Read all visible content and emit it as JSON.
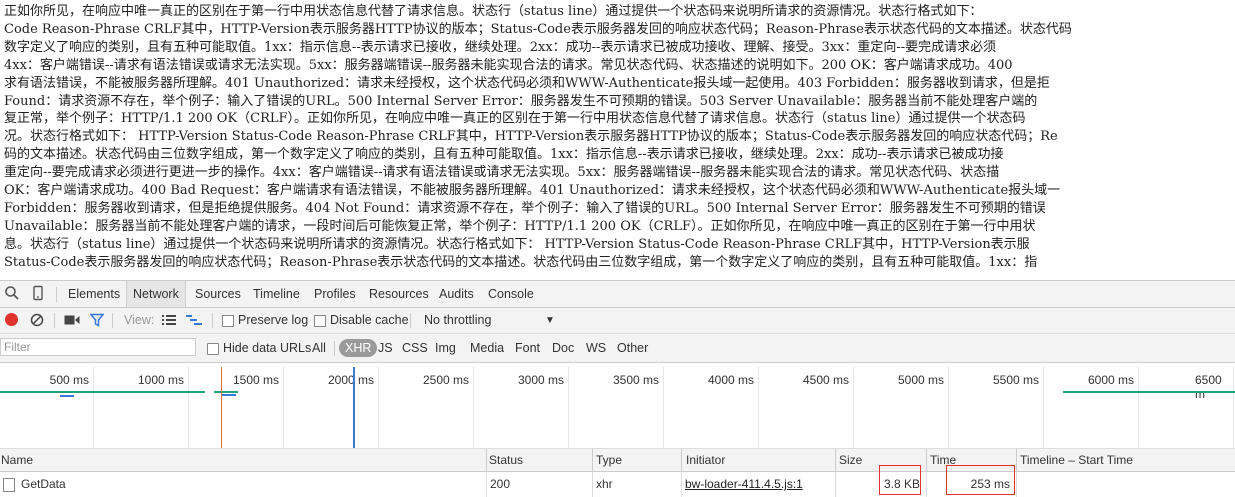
{
  "page_text": {
    "lines": [
      "正如你所见，在响应中唯一真正的区别在于第一行中用状态信息代替了请求信息。状态行（status line）通过提供一个状态码来说明所请求的资源情况。状态行格式如下：",
      "Code Reason-Phrase CRLF其中，HTTP-Version表示服务器HTTP协议的版本；Status-Code表示服务器发回的响应状态代码；Reason-Phrase表示状态代码的文本描述。状态代码",
      "数字定义了响应的类别，且有五种可能取值。1xx：指示信息--表示请求已接收，继续处理。2xx：成功--表示请求已被成功接收、理解、接受。3xx：重定向--要完成请求必须",
      "4xx：客户端错误--请求有语法错误或请求无法实现。5xx：服务器端错误--服务器未能实现合法的请求。常见状态代码、状态描述的说明如下。200 OK：客户端请求成功。400",
      "求有语法错误，不能被服务器所理解。401 Unauthorized：请求未经授权，这个状态代码必须和WWW-Authenticate报头域一起使用。403 Forbidden：服务器收到请求，但是拒",
      "Found：请求资源不存在，举个例子：输入了错误的URL。500 Internal Server Error：服务器发生不可预期的错误。503 Server Unavailable：服务器当前不能处理客户端的",
      "复正常，举个例子：HTTP/1.1 200 OK（CRLF）。正如你所见，在响应中唯一真正的区别在于第一行中用状态信息代替了请求信息。状态行（status line）通过提供一个状态码",
      "况。状态行格式如下：    HTTP-Version Status-Code Reason-Phrase CRLF其中，HTTP-Version表示服务器HTTP协议的版本；Status-Code表示服务器发回的响应状态代码；Re",
      "码的文本描述。状态代码由三位数字组成，第一个数字定义了响应的类别，且有五种可能取值。1xx：指示信息--表示请求已接收，继续处理。2xx：成功--表示请求已被成功接",
      "重定向--要完成请求必须进行更进一步的操作。4xx：客户端错误--请求有语法错误或请求无法实现。5xx：服务器端错误--服务器未能实现合法的请求。常见状态代码、状态描",
      "OK：客户端请求成功。400 Bad Request：客户端请求有语法错误，不能被服务器所理解。401 Unauthorized：请求未经授权，这个状态代码必须和WWW-Authenticate报头域一",
      "Forbidden：服务器收到请求，但是拒绝提供服务。404 Not Found：请求资源不存在，举个例子：输入了错误的URL。500 Internal Server Error：服务器发生不可预期的错误",
      "Unavailable：服务器当前不能处理客户端的请求，一段时间后可能恢复正常，举个例子：HTTP/1.1 200 OK（CRLF）。正如你所见，在响应中唯一真正的区别在于第一行中用状",
      "息。状态行（status line）通过提供一个状态码来说明所请求的资源情况。状态行格式如下：    HTTP-Version Status-Code Reason-Phrase CRLF其中，HTTP-Version表示服",
      "Status-Code表示服务器发回的响应状态代码；Reason-Phrase表示状态代码的文本描述。状态代码由三位数字组成，第一个数字定义了响应的类别，且有五种可能取值。1xx：指"
    ]
  },
  "devtools": {
    "tabs": [
      "Elements",
      "Network",
      "Sources",
      "Timeline",
      "Profiles",
      "Resources",
      "Audits",
      "Console"
    ],
    "active_tab": "Network",
    "toolbar": {
      "view_label": "View:",
      "preserve_log": "Preserve log",
      "disable_cache": "Disable cache",
      "throttling": "No throttling",
      "throttling_arrow": "▼"
    },
    "filter": {
      "placeholder": "Filter",
      "hide_data_urls": "Hide data URLs",
      "types": [
        "All",
        "XHR",
        "JS",
        "CSS",
        "Img",
        "Media",
        "Font",
        "Doc",
        "WS",
        "Other"
      ],
      "active_type": "XHR"
    },
    "overview_ticks": [
      "500 ms",
      "1000 ms",
      "1500 ms",
      "2000 ms",
      "2500 ms",
      "3000 ms",
      "3500 ms",
      "4000 ms",
      "4500 ms",
      "5000 ms",
      "5500 ms",
      "6000 ms",
      "6500 m"
    ],
    "table": {
      "columns": [
        "Name",
        "Status",
        "Type",
        "Initiator",
        "Size",
        "Time",
        "Timeline – Start Time"
      ],
      "rows": [
        {
          "name": "GetData",
          "status": "200",
          "type": "xhr",
          "initiator": "bw-loader-411.4.5.js:1",
          "size": "3.8 KB",
          "time": "253 ms"
        }
      ]
    },
    "colors": {
      "record": "#e0332e",
      "accent_blue": "#3879d9",
      "highlight": "#e03030",
      "timeline_green": "#25a17d"
    }
  }
}
